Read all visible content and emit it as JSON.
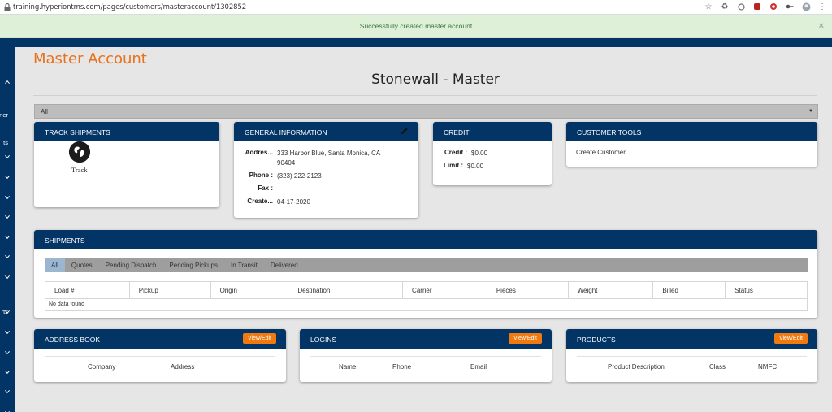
{
  "browser": {
    "url": "training.hyperiontms.com/pages/customers/masteraccount/1302852"
  },
  "notice": {
    "message": "Successfully created master account",
    "close": "×"
  },
  "sidebar": {
    "items": [
      {
        "text": "",
        "chevron": "up"
      },
      {
        "text": "ner",
        "chevron": "none"
      },
      {
        "text": "ts",
        "chevron": "none"
      },
      {
        "text": "",
        "chevron": "down"
      },
      {
        "text": "",
        "chevron": "down"
      },
      {
        "text": "",
        "chevron": "down"
      },
      {
        "text": "",
        "chevron": "down"
      },
      {
        "text": "",
        "chevron": "down"
      },
      {
        "text": "",
        "chevron": "down"
      },
      {
        "text": "",
        "chevron": "down"
      },
      {
        "text": "rts",
        "chevron": "down"
      },
      {
        "text": "",
        "chevron": "down"
      },
      {
        "text": "",
        "chevron": "down"
      },
      {
        "text": "",
        "chevron": "down"
      },
      {
        "text": "",
        "chevron": "down"
      },
      {
        "text": "",
        "chevron": "down"
      }
    ]
  },
  "page": {
    "title": "Master Account",
    "account_name": "Stonewall - Master",
    "filter_value": "All"
  },
  "track": {
    "header": "TRACK SHIPMENTS",
    "label": "Track"
  },
  "general": {
    "header": "GENERAL INFORMATION",
    "rows": [
      {
        "key": "Addres...",
        "value": "333 Harbor Blue, Santa Monica, CA 90404"
      },
      {
        "key": "Phone :",
        "value": "(323) 222-2123"
      },
      {
        "key": "Fax :",
        "value": ""
      },
      {
        "key": "Create...",
        "value": "04-17-2020"
      }
    ]
  },
  "credit": {
    "header": "CREDIT",
    "rows": [
      {
        "key": "Credit :",
        "value": "$0.00"
      },
      {
        "key": "Limit :",
        "value": "$0.00"
      }
    ]
  },
  "tools": {
    "header": "CUSTOMER TOOLS",
    "link": "Create Customer"
  },
  "shipments": {
    "header": "SHIPMENTS",
    "tabs": [
      "All",
      "Quotes",
      "Pending Dispatch",
      "Pending Pickups",
      "In Transit",
      "Delivered"
    ],
    "columns": [
      "Load #",
      "Pickup",
      "Origin",
      "Destination",
      "Carrier",
      "Pieces",
      "Weight",
      "Billed",
      "Status"
    ],
    "empty": "No data found"
  },
  "address_book": {
    "header": "ADDRESS BOOK",
    "button": "View/Edit",
    "columns": [
      "Company",
      "Address"
    ]
  },
  "logins": {
    "header": "LOGINS",
    "button": "View/Edit",
    "columns": [
      "Name",
      "Phone",
      "Email"
    ]
  },
  "products": {
    "header": "PRODUCTS",
    "button": "View/Edit",
    "columns": [
      "Product Description",
      "Class",
      "NMFC"
    ]
  },
  "colors": {
    "navy": "#023466",
    "orange": "#e8711c",
    "button_orange": "#f07a10",
    "notice_green": "#dff0d8"
  }
}
